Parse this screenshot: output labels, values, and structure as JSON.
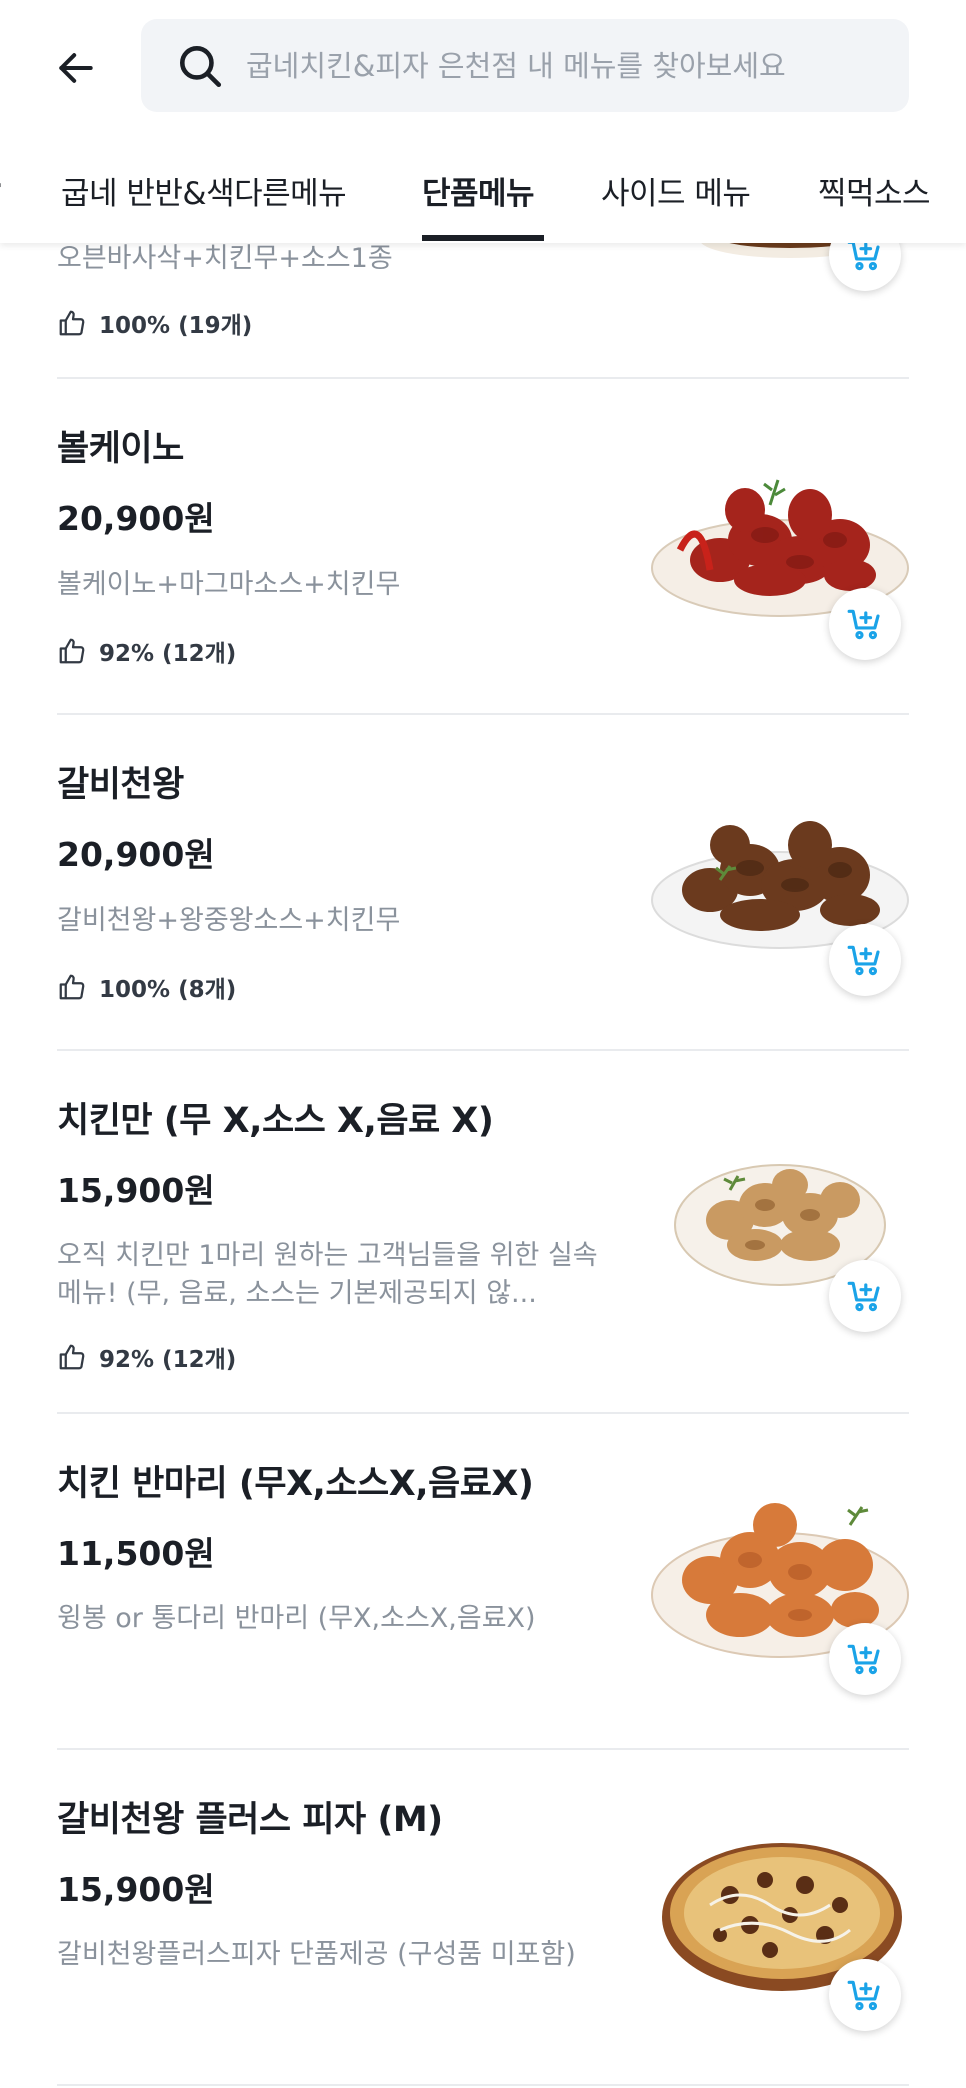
{
  "search": {
    "placeholder": "굽네치킨&피자 은천점 내 메뉴를 찾아보세요"
  },
  "tabs": [
    {
      "label": "굽네 반반&색다른메뉴"
    },
    {
      "label": "단품메뉴"
    },
    {
      "label": "사이드 메뉴"
    },
    {
      "label": "찍먹소스"
    }
  ],
  "active_tab": "단품메뉴",
  "colors": {
    "accent": "#1aa3e8",
    "text": "#1b1f26",
    "muted": "#8a929c"
  },
  "items": [
    {
      "desc": "오븐바사삭+치킨무+소스1종",
      "rating": "100% (19개)"
    },
    {
      "name": "볼케이노",
      "price": "20,900원",
      "desc": "볼케이노+마그마소스+치킨무",
      "rating": "92% (12개)"
    },
    {
      "name": "갈비천왕",
      "price": "20,900원",
      "desc": "갈비천왕+왕중왕소스+치킨무",
      "rating": "100% (8개)"
    },
    {
      "name": "치킨만 (무 X,소스 X,음료 X)",
      "price": "15,900원",
      "desc": "오직 치킨만 1마리 원하는 고객님들을 위한 실속메뉴! (무, 음료, 소스는 기본제공되지 않...",
      "rating": "92% (12개)"
    },
    {
      "name": "치킨 반마리 (무X,소스X,음료X)",
      "price": "11,500원",
      "desc": "윙봉 or 통다리 반마리 (무X,소스X,음료X)"
    },
    {
      "name": "갈비천왕 플러스 피자 (M)",
      "price": "15,900원",
      "desc": "갈비천왕플러스피자 단품제공 (구성품 미포함)"
    }
  ]
}
